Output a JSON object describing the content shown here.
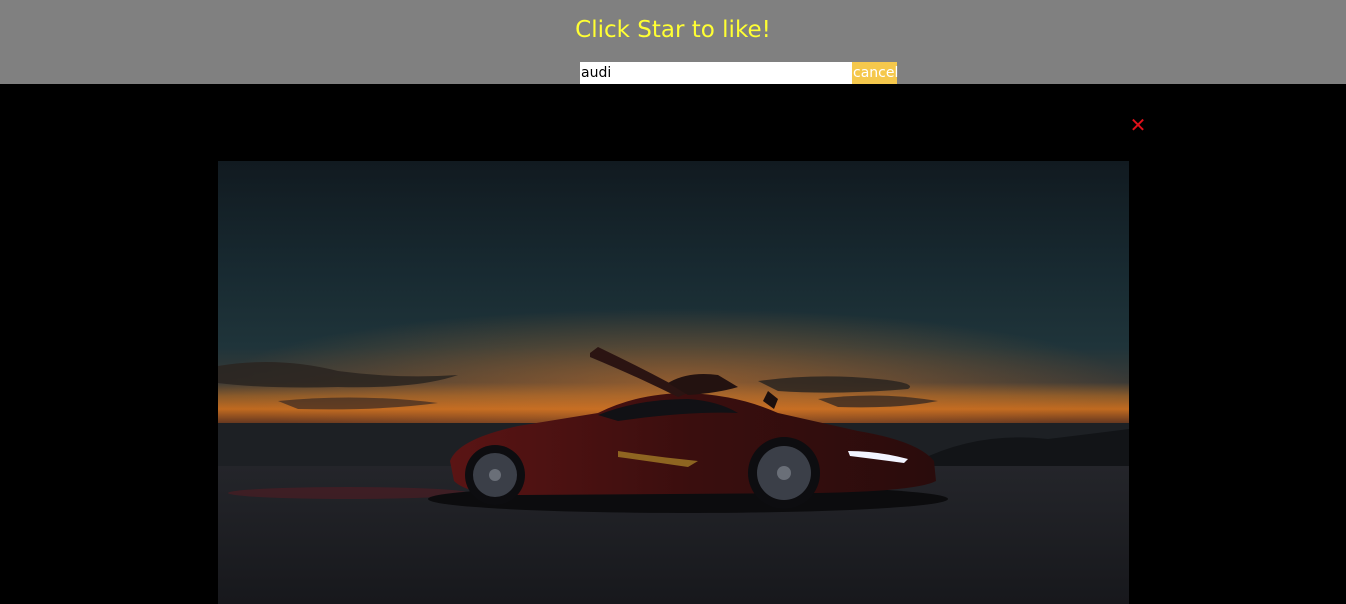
{
  "header": {
    "title": "Click Star to like!",
    "search": {
      "value": "audi",
      "placeholder": ""
    },
    "cancel_label": "cancel"
  },
  "modal": {
    "close_icon": "close-icon",
    "close_glyph": "✕",
    "photo": {
      "subject": "car-photo"
    }
  },
  "colors": {
    "header_bg": "#808080",
    "title_color": "#ffff33",
    "cancel_bg": "#f5c84c",
    "close_color": "#e0101a",
    "modal_bg": "#000000"
  }
}
